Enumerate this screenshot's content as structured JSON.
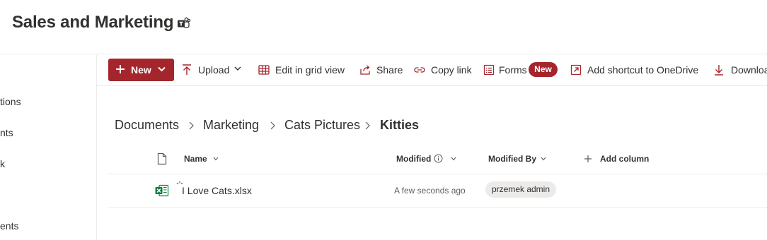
{
  "site": {
    "title": "Sales and Marketing",
    "teams_icon": "teams-icon"
  },
  "nav": {
    "items": [
      "tions",
      "nts",
      "k",
      "ents"
    ]
  },
  "commands": {
    "new_label": "New",
    "upload_label": "Upload",
    "edit_grid_label": "Edit in grid view",
    "share_label": "Share",
    "copy_link_label": "Copy link",
    "forms_label": "Forms",
    "forms_badge": "New",
    "add_shortcut_label": "Add shortcut to OneDrive",
    "download_label": "Downloa"
  },
  "breadcrumb": [
    "Documents",
    "Marketing",
    "Cats Pictures",
    "Kitties"
  ],
  "columns": {
    "name": "Name",
    "modified": "Modified",
    "modified_by": "Modified By",
    "add_column": "Add column"
  },
  "files": [
    {
      "name": "I Love Cats.xlsx",
      "modified": "A few seconds ago",
      "modified_by": "przemek admin",
      "icon": "excel-file-icon",
      "is_new": true
    }
  ],
  "colors": {
    "accent": "#a4262c",
    "excel": "#107c41"
  }
}
